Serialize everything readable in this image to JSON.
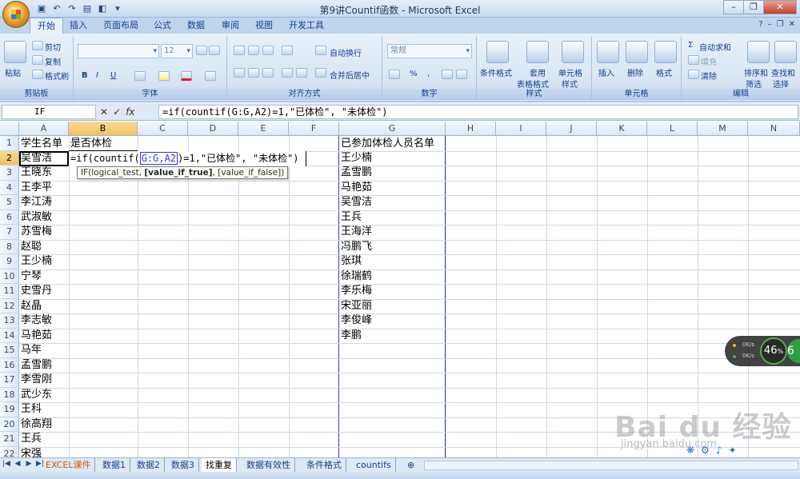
{
  "window": {
    "title": "第9讲Countif函数 - Microsoft Excel"
  },
  "tabs": [
    "开始",
    "插入",
    "页面布局",
    "公式",
    "数据",
    "审阅",
    "视图",
    "开发工具"
  ],
  "ribbon": {
    "clipboard": {
      "paste": "粘贴",
      "cut": "剪切",
      "copy": "复制",
      "format_painter": "格式刷",
      "label": "剪贴板"
    },
    "font": {
      "size": "12",
      "label": "字体",
      "bold": "B",
      "italic": "I",
      "underline": "U"
    },
    "alignment": {
      "wrap": "自动换行",
      "merge": "合并后居中",
      "label": "对齐方式"
    },
    "number": {
      "format": "常规",
      "percent": "%",
      "comma": ",",
      "label": "数字"
    },
    "styles": {
      "conditional": "条件格式",
      "table_1": "套用",
      "table_2": "表格格式",
      "cell_1": "单元格",
      "cell_2": "样式",
      "label": "样式"
    },
    "cells": {
      "insert": "插入",
      "delete": "删除",
      "format": "格式",
      "label": "单元格"
    },
    "editing": {
      "autosum": "自动求和",
      "fill": "填充",
      "clear": "清除",
      "sort_1": "排序和",
      "sort_2": "筛选",
      "find_1": "查找和",
      "find_2": "选择",
      "label": "编辑"
    }
  },
  "formula_bar": {
    "name_box": "IF",
    "fx": "fx",
    "formula": "=if(countif(G:G,A2)=1,\"已体检\", \"未体检\")"
  },
  "columns": [
    "A",
    "B",
    "C",
    "D",
    "E",
    "F",
    "G",
    "H",
    "I",
    "J",
    "K",
    "L",
    "M",
    "N"
  ],
  "rows": [
    "1",
    "2",
    "3",
    "4",
    "5",
    "6",
    "7",
    "8",
    "9",
    "10",
    "11",
    "12",
    "13",
    "14",
    "15",
    "16",
    "17",
    "18",
    "19",
    "20",
    "21",
    "22"
  ],
  "sheet_cells": {
    "a1": "学生名单",
    "b1": "是否体检",
    "g1": "已参加体检人员名单",
    "column_a": [
      "吴雪洁",
      "王晓东",
      "王李平",
      "李江涛",
      "武淑敏",
      "苏雪梅",
      "赵聪",
      "王少楠",
      "宁琴",
      "史雪丹",
      "赵晶",
      "李志敏",
      "马艳茹",
      "马年",
      "孟雪鹏",
      "李雪刚",
      "武少东",
      "王科",
      "徐高翔",
      "王兵",
      "宋强"
    ],
    "column_g": [
      "王少楠",
      "孟雪鹏",
      "马艳茹",
      "吴雪洁",
      "王兵",
      "王海洋",
      "冯鹏飞",
      "张琪",
      "徐瑞鹤",
      "李乐梅",
      "宋亚丽",
      "李俊峰",
      "李鹏"
    ]
  },
  "editing_cell": {
    "prefix": "=if(countif(",
    "ref": "G:G,A2",
    "suffix": ")=1,\"已体检\", \"未体检\")"
  },
  "tooltip": {
    "fn": "IF(logical_test, ",
    "bold_arg": "[value_if_true]",
    "rest": ", [value_if_false])"
  },
  "sheet_tabs": [
    "EXCEL课件",
    "数据1",
    "数据2",
    "数据3",
    "找重复",
    "数据有效性",
    "条件格式",
    "countifs"
  ],
  "widget": {
    "percent": "46",
    "unit": "%",
    "up": "0K/s",
    "down": "0K/s",
    "badge": "6"
  },
  "watermark": {
    "brand": "Bai du 经验",
    "url": "jingyan.baidu.com"
  },
  "colors": {
    "accent": "#15428b",
    "ribbon_bg": "#dbe7f5",
    "selection": "#f1c15f",
    "blue_border": "#3a3acc"
  }
}
